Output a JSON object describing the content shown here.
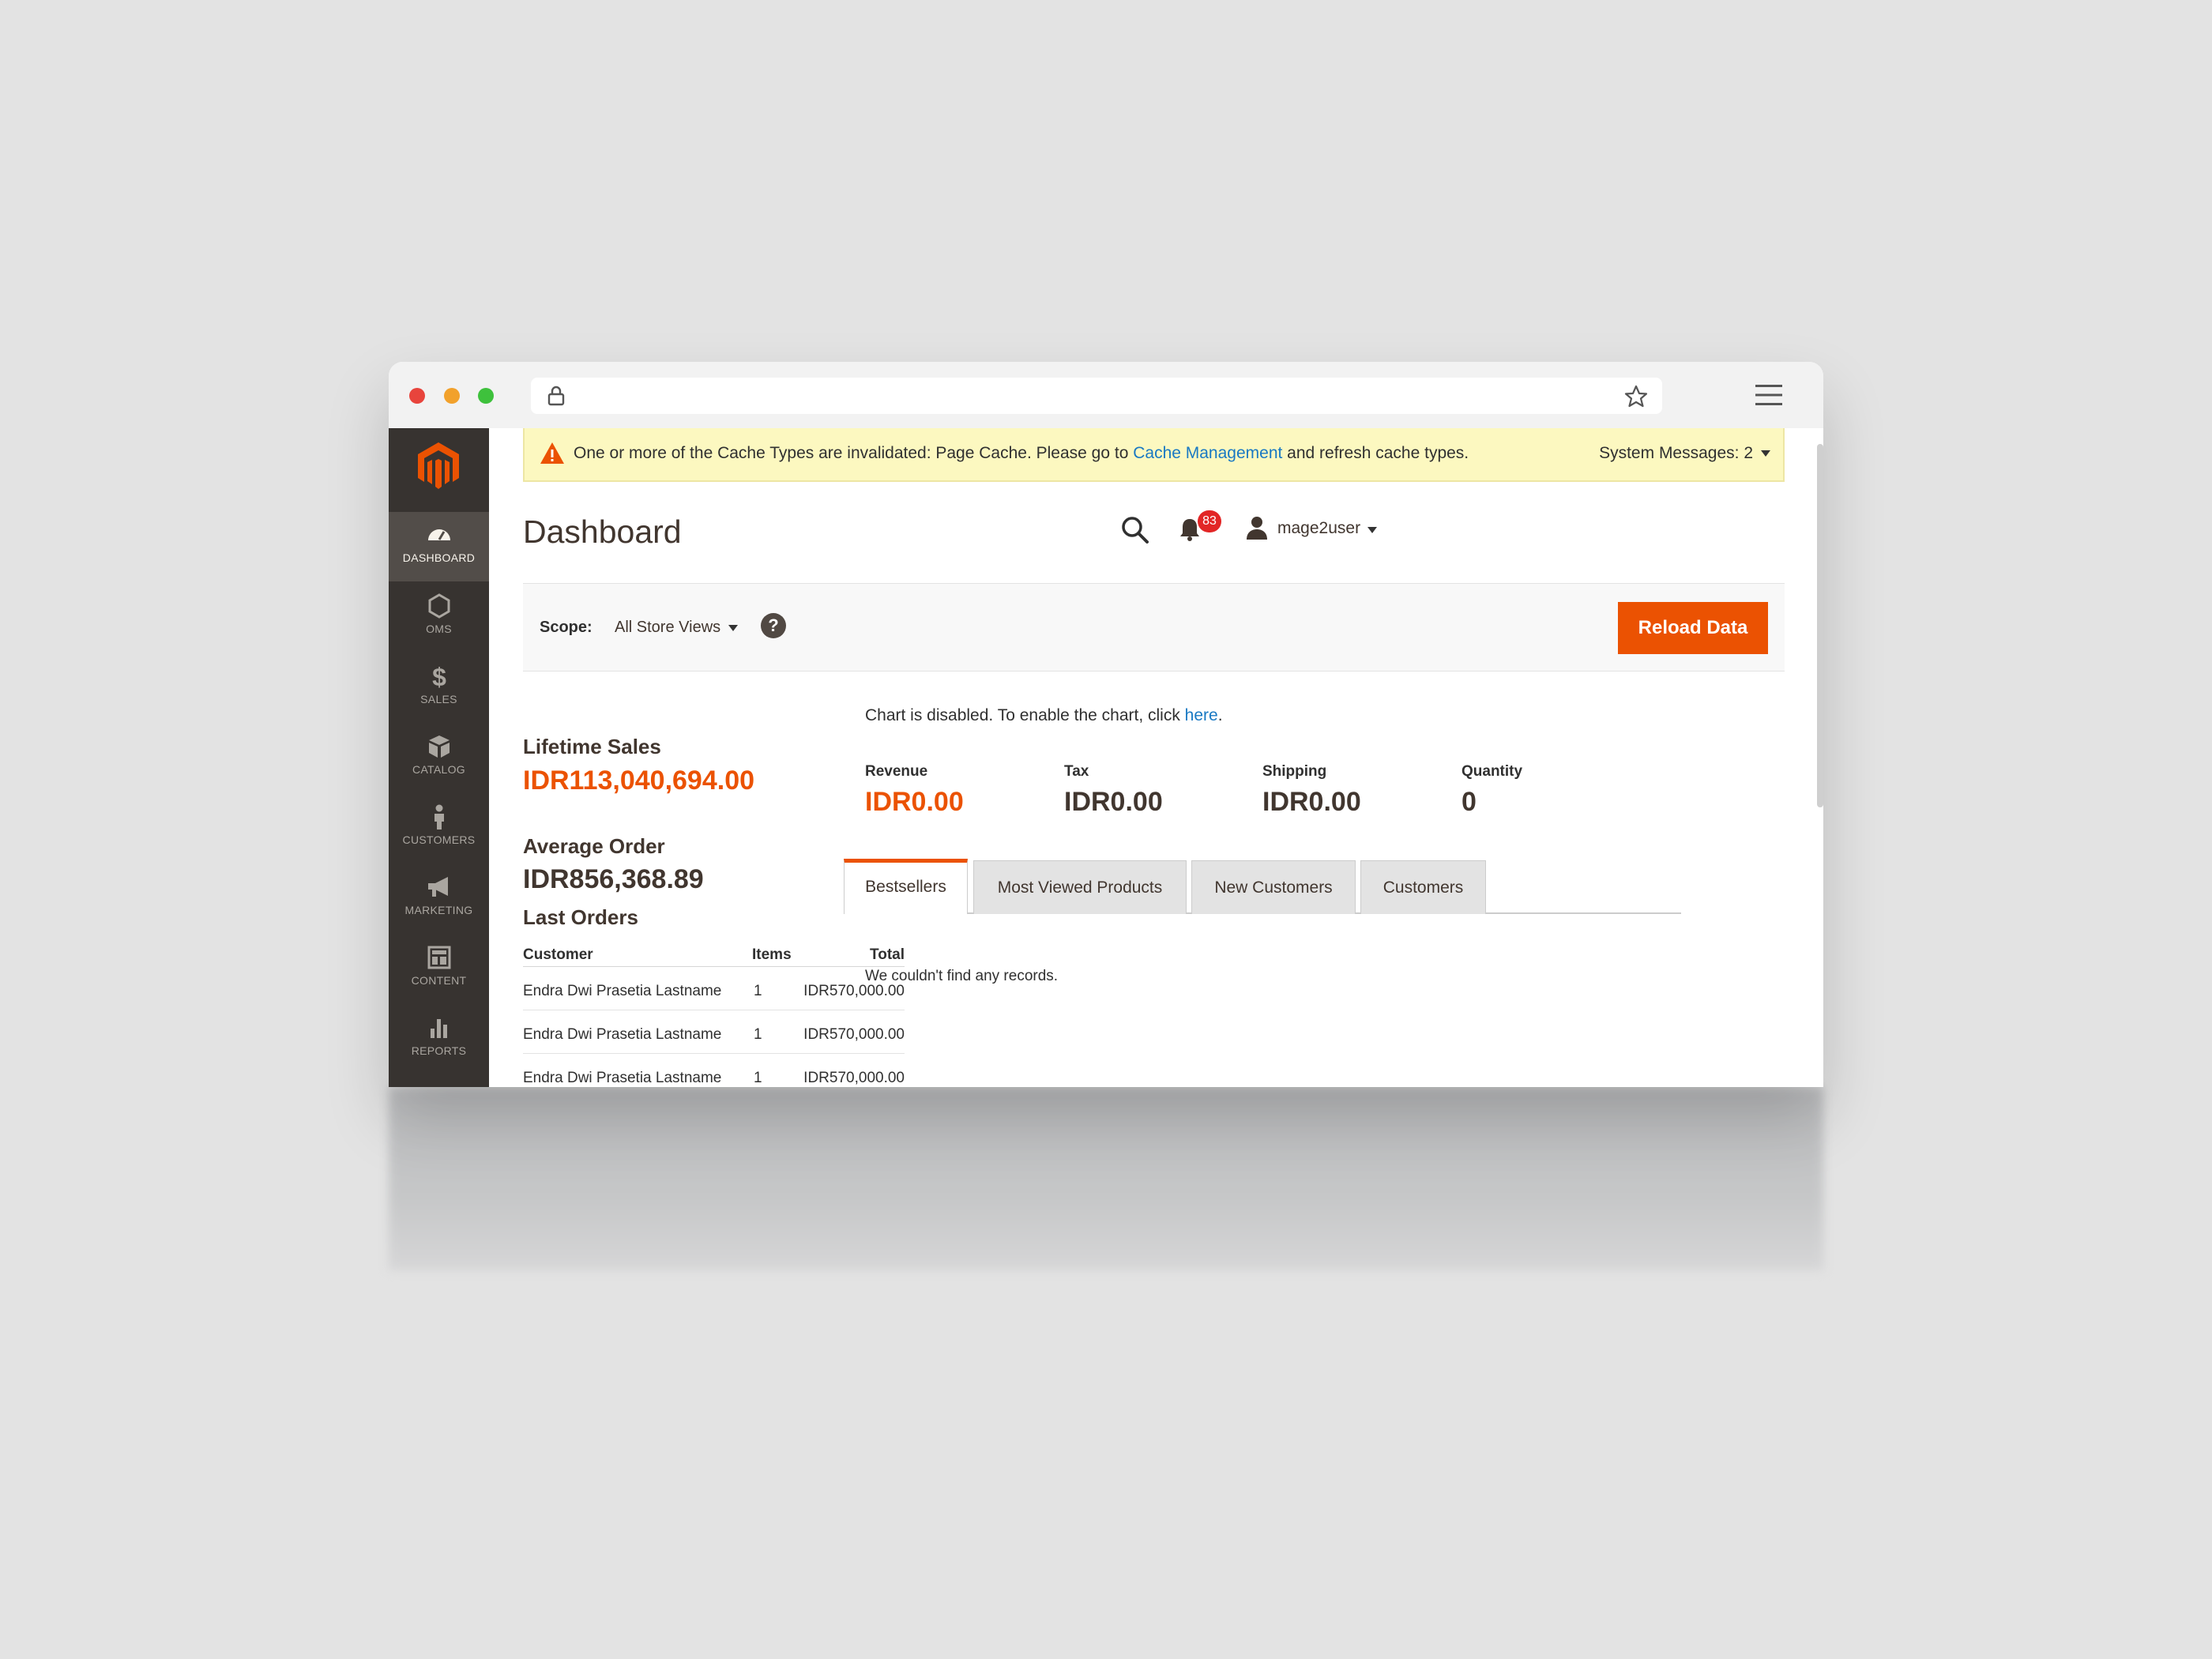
{
  "notice": {
    "text_before": "One or more of the Cache Types are invalidated: Page Cache. Please go to ",
    "link": "Cache Management",
    "text_after": " and refresh cache types.",
    "system_messages": "System Messages: 2"
  },
  "sidebar": {
    "items": [
      {
        "label": "DASHBOARD",
        "icon": "dashboard-icon"
      },
      {
        "label": "OMS",
        "icon": "hexagon-icon"
      },
      {
        "label": "SALES",
        "icon": "dollar-icon"
      },
      {
        "label": "CATALOG",
        "icon": "box-icon"
      },
      {
        "label": "CUSTOMERS",
        "icon": "person-icon"
      },
      {
        "label": "MARKETING",
        "icon": "megaphone-icon"
      },
      {
        "label": "CONTENT",
        "icon": "layout-icon"
      },
      {
        "label": "REPORTS",
        "icon": "bar-chart-icon"
      }
    ]
  },
  "header": {
    "title": "Dashboard",
    "notifications": "83",
    "user": "mage2user"
  },
  "scope": {
    "label": "Scope:",
    "value": "All Store Views",
    "help": "?",
    "reload": "Reload Data"
  },
  "stats": {
    "lifetime_label": "Lifetime Sales",
    "lifetime_value": "IDR113,040,694.00",
    "average_label": "Average Order",
    "average_value": "IDR856,368.89"
  },
  "orders": {
    "title": "Last Orders",
    "headers": {
      "customer": "Customer",
      "items": "Items",
      "total": "Total"
    },
    "rows": [
      {
        "customer": "Endra Dwi Prasetia Lastname",
        "items": "1",
        "total": "IDR570,000.00"
      },
      {
        "customer": "Endra Dwi Prasetia Lastname",
        "items": "1",
        "total": "IDR570,000.00"
      },
      {
        "customer": "Endra Dwi Prasetia Lastname",
        "items": "1",
        "total": "IDR570,000.00"
      }
    ]
  },
  "chart": {
    "msg_before": "Chart is disabled. To enable the chart, click ",
    "msg_link": "here",
    "msg_after": "."
  },
  "metrics": [
    {
      "label": "Revenue",
      "value": "IDR0.00"
    },
    {
      "label": "Tax",
      "value": "IDR0.00"
    },
    {
      "label": "Shipping",
      "value": "IDR0.00"
    },
    {
      "label": "Quantity",
      "value": "0"
    }
  ],
  "tabs": [
    {
      "label": "Bestsellers"
    },
    {
      "label": "Most Viewed Products"
    },
    {
      "label": "New Customers"
    },
    {
      "label": "Customers"
    }
  ],
  "empty_msg": "We couldn't find any records.",
  "colors": {
    "accent": "#eb5202",
    "sidebar": "#373330",
    "link": "#1979c3",
    "notice_bg": "#fcf8c0",
    "badge": "#e22626"
  }
}
